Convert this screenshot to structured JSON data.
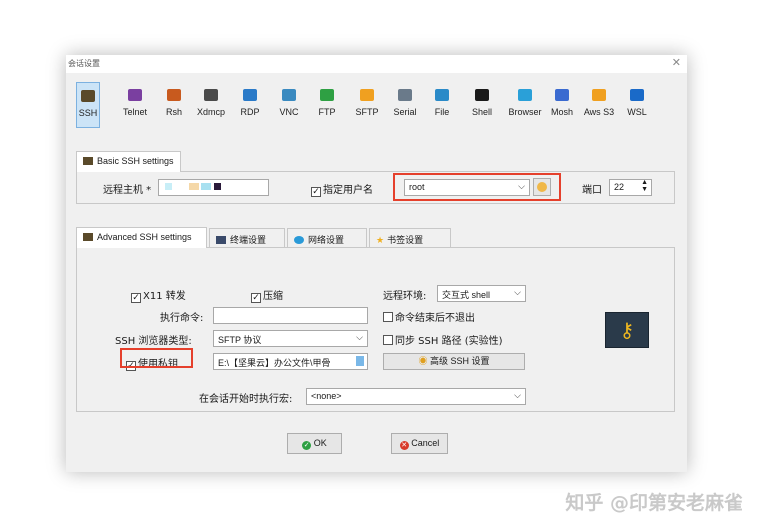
{
  "window": {
    "title": "会话设置"
  },
  "protocols": [
    {
      "label": "SSH",
      "icon": "ssh-icon",
      "color": "#5a4a2a"
    },
    {
      "label": "Telnet",
      "icon": "telnet-icon",
      "color": "#7a3fa0"
    },
    {
      "label": "Rsh",
      "icon": "rsh-icon",
      "color": "#c85a1e"
    },
    {
      "label": "Xdmcp",
      "icon": "xdmcp-icon",
      "color": "#4a4a4a"
    },
    {
      "label": "RDP",
      "icon": "rdp-icon",
      "color": "#2a7ac8"
    },
    {
      "label": "VNC",
      "icon": "vnc-icon",
      "color": "#3a8ac0"
    },
    {
      "label": "FTP",
      "icon": "ftp-icon",
      "color": "#2ea043"
    },
    {
      "label": "SFTP",
      "icon": "sftp-icon",
      "color": "#f0a020"
    },
    {
      "label": "Serial",
      "icon": "serial-icon",
      "color": "#6a7a8a"
    },
    {
      "label": "File",
      "icon": "file-icon",
      "color": "#2a8ac8"
    },
    {
      "label": "Shell",
      "icon": "shell-icon",
      "color": "#1a1a1a"
    },
    {
      "label": "Browser",
      "icon": "browser-icon",
      "color": "#2aa0d8"
    },
    {
      "label": "Mosh",
      "icon": "mosh-icon",
      "color": "#3a6ad0"
    },
    {
      "label": "Aws S3",
      "icon": "aws-s3-icon",
      "color": "#f0a020"
    },
    {
      "label": "WSL",
      "icon": "wsl-icon",
      "color": "#1a6ac8"
    }
  ],
  "basic": {
    "tab_label": "Basic SSH settings",
    "remote_host_label": "远程主机 *",
    "specify_user_label": "指定用户名",
    "username_value": "root",
    "port_label": "端口",
    "port_value": "22"
  },
  "advanced_tabs": [
    {
      "label": "Advanced SSH settings"
    },
    {
      "label": "终端设置"
    },
    {
      "label": "网络设置"
    },
    {
      "label": "书签设置"
    }
  ],
  "advanced": {
    "x11_label": "X11 转发",
    "compression_label": "压缩",
    "remote_env_label": "远程环境:",
    "remote_env_value": "交互式 shell",
    "exec_command_label": "执行命令:",
    "exec_command_value": "",
    "no_exit_label": "命令结束后不退出",
    "browser_type_label": "SSH 浏览器类型:",
    "browser_type_value": "SFTP 协议",
    "follow_path_label": "同步 SSH 路径 (实验性)",
    "use_key_label": "使用私钥",
    "key_path_value": "E:\\【坚果云】办公文件\\甲骨",
    "advanced_ssh_button": "高级 SSH 设置",
    "macro_label": "在会话开始时执行宏:",
    "macro_value": "<none>"
  },
  "buttons": {
    "ok": "OK",
    "cancel": "Cancel"
  },
  "watermark": "知乎 @印第安老麻雀"
}
